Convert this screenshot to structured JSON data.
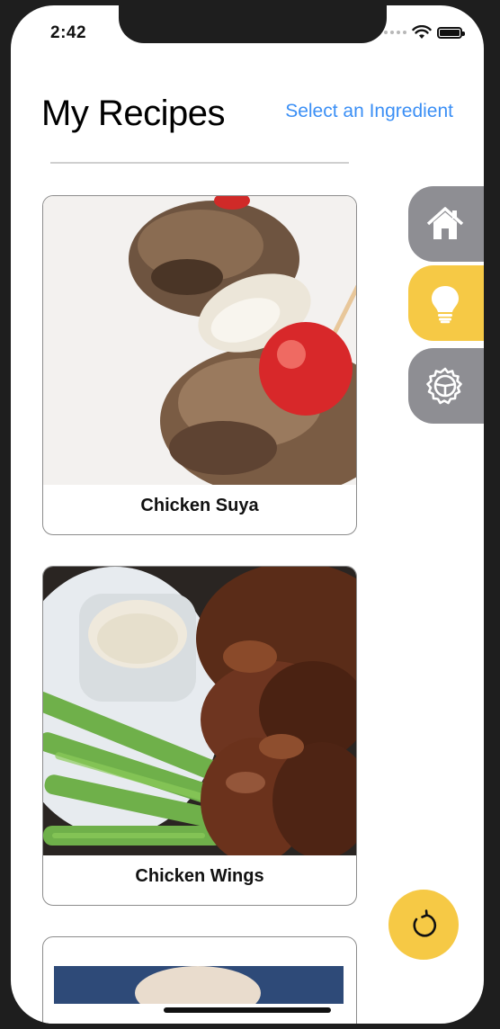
{
  "status_bar": {
    "time": "2:42"
  },
  "header": {
    "title": "My Recipes",
    "ingredient_link": "Select an Ingredient"
  },
  "recipes": [
    {
      "label": "Chicken Suya"
    },
    {
      "label": "Chicken Wings"
    },
    {
      "label": ""
    }
  ],
  "side_nav": {
    "items": [
      {
        "icon": "home-icon",
        "color": "#8e8e93"
      },
      {
        "icon": "lightbulb-icon",
        "color": "#f6c945"
      },
      {
        "icon": "settings-icon",
        "color": "#8e8e93"
      }
    ]
  },
  "refresh_button": {
    "icon": "refresh-icon",
    "color": "#f6c945"
  },
  "colors": {
    "accent": "#3b8ff5",
    "highlight": "#f6c945",
    "nav_gray": "#8e8e93"
  }
}
